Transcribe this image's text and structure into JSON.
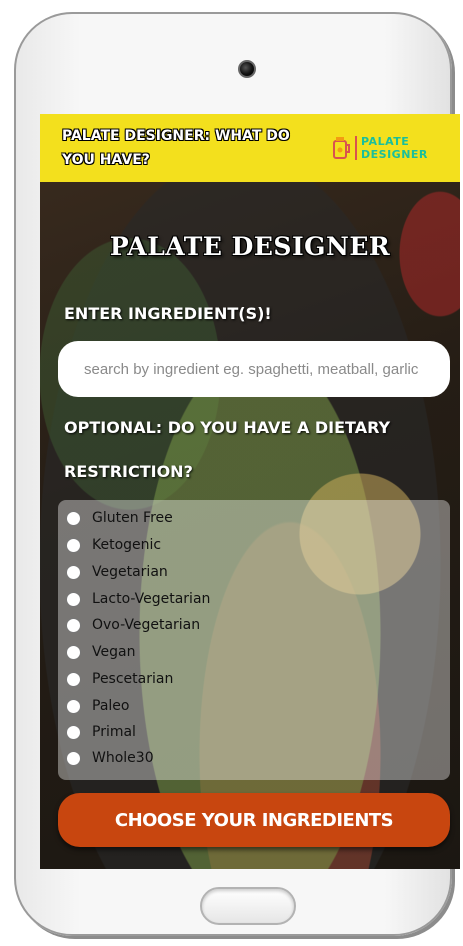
{
  "header": {
    "title": "PALATE DESIGNER: WHAT DO YOU HAVE?",
    "logo_line1": "PALATE",
    "logo_line2": "DESIGNER"
  },
  "main": {
    "title": "PALATE DESIGNER",
    "ingredient_label": "ENTER INGREDIENT(S)!",
    "search_placeholder": "search by ingredient eg. spaghetti, meatball, garlic",
    "dietary_label": "OPTIONAL: DO YOU HAVE A DIETARY RESTRICTION?",
    "options": [
      {
        "label": "Gluten Free"
      },
      {
        "label": "Ketogenic"
      },
      {
        "label": "Vegetarian"
      },
      {
        "label": "Lacto-Vegetarian"
      },
      {
        "label": "Ovo-Vegetarian"
      },
      {
        "label": "Vegan"
      },
      {
        "label": "Pescetarian"
      },
      {
        "label": "Paleo"
      },
      {
        "label": "Primal"
      },
      {
        "label": "Whole30"
      }
    ],
    "cta_label": "CHOOSE YOUR INGREDIENTS"
  },
  "colors": {
    "header_bg": "#f3e01d",
    "logo_text": "#1bbf9c",
    "cta_bg": "#c8460f"
  }
}
